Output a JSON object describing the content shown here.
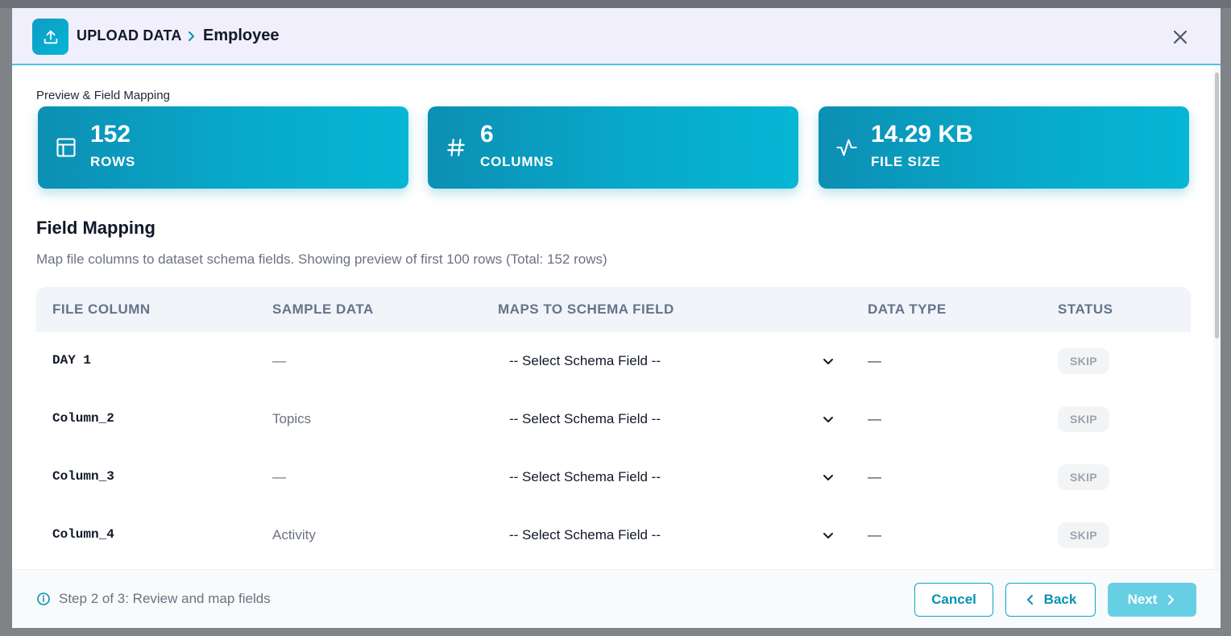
{
  "header": {
    "breadcrumb_root": "UPLOAD DATA",
    "breadcrumb_current": "Employee",
    "upload_icon": "upload-icon",
    "close_icon": "close-icon"
  },
  "preview": {
    "section_label": "Preview & Field Mapping",
    "stats": [
      {
        "value": "152",
        "label": "ROWS",
        "icon": "table-icon"
      },
      {
        "value": "6",
        "label": "COLUMNS",
        "icon": "hash-icon"
      },
      {
        "value": "14.29 KB",
        "label": "FILE SIZE",
        "icon": "activity-icon"
      }
    ]
  },
  "mapping": {
    "title": "Field Mapping",
    "description": "Map file columns to dataset schema fields. Showing preview of first 100 rows (Total: 152 rows)",
    "headers": {
      "file_column": "FILE COLUMN",
      "sample_data": "SAMPLE DATA",
      "maps_to": "MAPS TO SCHEMA FIELD",
      "data_type": "DATA TYPE",
      "status": "STATUS"
    },
    "rows": [
      {
        "file_column": "DAY 1",
        "sample": "—",
        "schema_field": "-- Select Schema Field --",
        "data_type": "—",
        "status": "SKIP"
      },
      {
        "file_column": "Column_2",
        "sample": "Topics",
        "schema_field": "-- Select Schema Field --",
        "data_type": "—",
        "status": "SKIP"
      },
      {
        "file_column": "Column_3",
        "sample": "—",
        "schema_field": "-- Select Schema Field --",
        "data_type": "—",
        "status": "SKIP"
      },
      {
        "file_column": "Column_4",
        "sample": "Activity",
        "schema_field": "-- Select Schema Field --",
        "data_type": "—",
        "status": "SKIP"
      }
    ]
  },
  "footer": {
    "step_text": "Step 2 of 3: Review and map fields",
    "cancel_label": "Cancel",
    "back_label": "Back",
    "next_label": "Next"
  },
  "colors": {
    "accent": "#06b6d4",
    "accent_dark": "#0c8fb3",
    "header_bg": "#f1effc",
    "next_disabled": "#67cfe4"
  }
}
